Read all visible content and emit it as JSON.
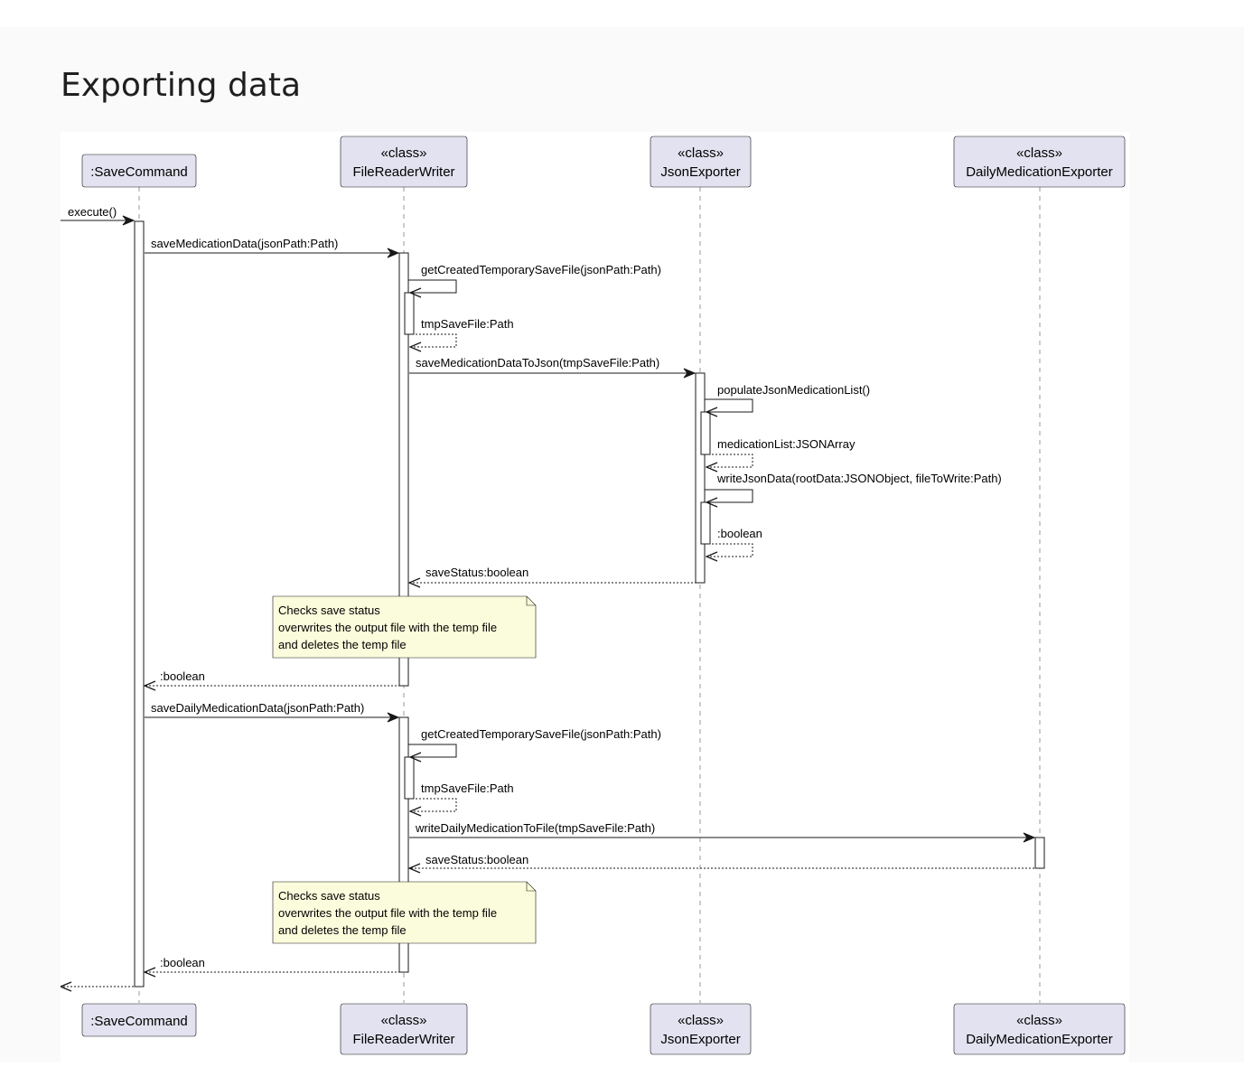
{
  "title": "Exporting data",
  "colors": {
    "participant_fill": "#e2e2f0",
    "participant_stroke": "#181818",
    "note_fill": "#fbfcdc",
    "line": "#181818",
    "lifeline": "#999999"
  },
  "participants": [
    {
      "key": "save",
      "stereotype": "",
      "name": ":SaveCommand"
    },
    {
      "key": "frw",
      "stereotype": "«class»",
      "name": "FileReaderWriter"
    },
    {
      "key": "json",
      "stereotype": "«class»",
      "name": "JsonExporter"
    },
    {
      "key": "daily",
      "stereotype": "«class»",
      "name": "DailyMedicationExporter"
    }
  ],
  "messages": [
    {
      "from": "entry",
      "to": "save",
      "label": "execute()",
      "style": "sync"
    },
    {
      "from": "save",
      "to": "frw",
      "label": "saveMedicationData(jsonPath:Path)",
      "style": "sync"
    },
    {
      "from": "frw",
      "to": "frw",
      "label": "getCreatedTemporarySaveFile(jsonPath:Path)",
      "style": "self"
    },
    {
      "from": "frw",
      "to": "frw",
      "label": "tmpSaveFile:Path",
      "style": "self-return"
    },
    {
      "from": "frw",
      "to": "json",
      "label": "saveMedicationDataToJson(tmpSaveFile:Path)",
      "style": "sync"
    },
    {
      "from": "json",
      "to": "json",
      "label": "populateJsonMedicationList()",
      "style": "self"
    },
    {
      "from": "json",
      "to": "json",
      "label": "medicationList:JSONArray",
      "style": "self-return"
    },
    {
      "from": "json",
      "to": "json",
      "label": "writeJsonData(rootData:JSONObject, fileToWrite:Path)",
      "style": "self"
    },
    {
      "from": "json",
      "to": "json",
      "label": ":boolean",
      "style": "self-return"
    },
    {
      "from": "json",
      "to": "frw",
      "label": "saveStatus:boolean",
      "style": "return"
    },
    {
      "from": "frw",
      "to": "save",
      "label": ":boolean",
      "style": "return"
    },
    {
      "from": "save",
      "to": "frw",
      "label": "saveDailyMedicationData(jsonPath:Path)",
      "style": "sync"
    },
    {
      "from": "frw",
      "to": "frw",
      "label": "getCreatedTemporarySaveFile(jsonPath:Path)",
      "style": "self"
    },
    {
      "from": "frw",
      "to": "frw",
      "label": "tmpSaveFile:Path",
      "style": "self-return"
    },
    {
      "from": "frw",
      "to": "daily",
      "label": "writeDailyMedicationToFile(tmpSaveFile:Path)",
      "style": "sync"
    },
    {
      "from": "daily",
      "to": "frw",
      "label": "saveStatus:boolean",
      "style": "return"
    },
    {
      "from": "frw",
      "to": "save",
      "label": ":boolean",
      "style": "return"
    },
    {
      "from": "save",
      "to": "entry",
      "label": "",
      "style": "return"
    }
  ],
  "notes": [
    {
      "lines": [
        "Checks save status",
        "overwrites the output file with the temp file",
        "and deletes the temp file"
      ]
    },
    {
      "lines": [
        "Checks save status",
        "overwrites the output file with the temp file",
        "and deletes the temp file"
      ]
    }
  ]
}
